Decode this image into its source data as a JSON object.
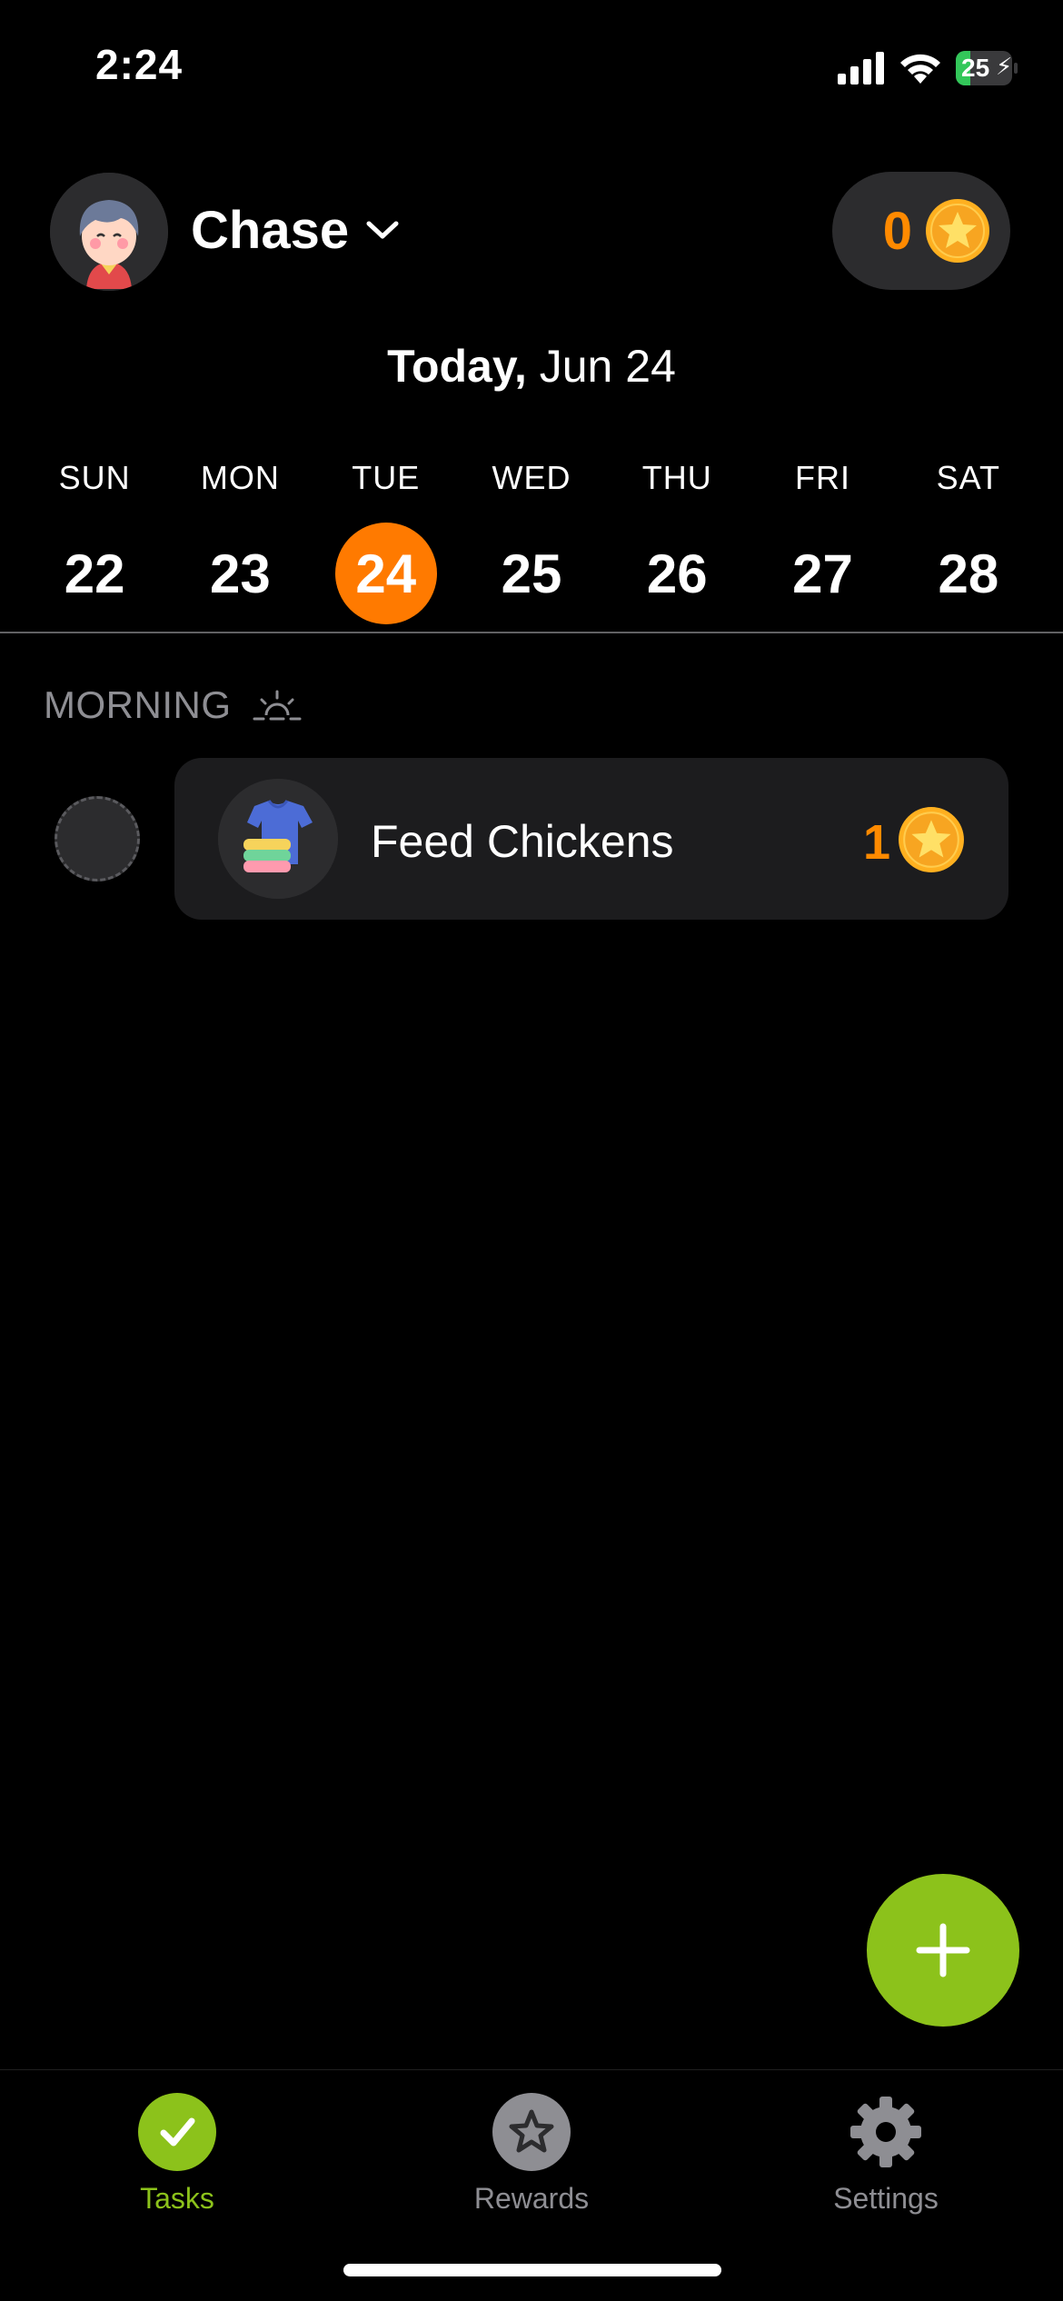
{
  "status_bar": {
    "time": "2:24",
    "battery_level": "25"
  },
  "header": {
    "user_name": "Chase",
    "coin_count": "0"
  },
  "date_header": {
    "today_prefix": "Today,",
    "date": "Jun 24"
  },
  "week": {
    "selected_index": 2,
    "days": [
      {
        "name": "SUN",
        "num": "22"
      },
      {
        "name": "MON",
        "num": "23"
      },
      {
        "name": "TUE",
        "num": "24"
      },
      {
        "name": "WED",
        "num": "25"
      },
      {
        "name": "THU",
        "num": "26"
      },
      {
        "name": "FRI",
        "num": "27"
      },
      {
        "name": "SAT",
        "num": "28"
      }
    ]
  },
  "section": {
    "title": "MORNING",
    "icon": "sunrise-icon"
  },
  "tasks": [
    {
      "title": "Feed Chickens",
      "points": "1",
      "icon": "clothes-icon"
    }
  ],
  "tabs": [
    {
      "label": "Tasks",
      "icon": "check-icon",
      "active": true
    },
    {
      "label": "Rewards",
      "icon": "star-icon",
      "active": false
    },
    {
      "label": "Settings",
      "icon": "gear-icon",
      "active": false
    }
  ],
  "colors": {
    "accent_orange": "#ff7a00",
    "accent_green": "#8cc21b",
    "coin_gold": "#f7a521",
    "card_bg": "#1c1c1e",
    "muted": "#8e8e93"
  }
}
